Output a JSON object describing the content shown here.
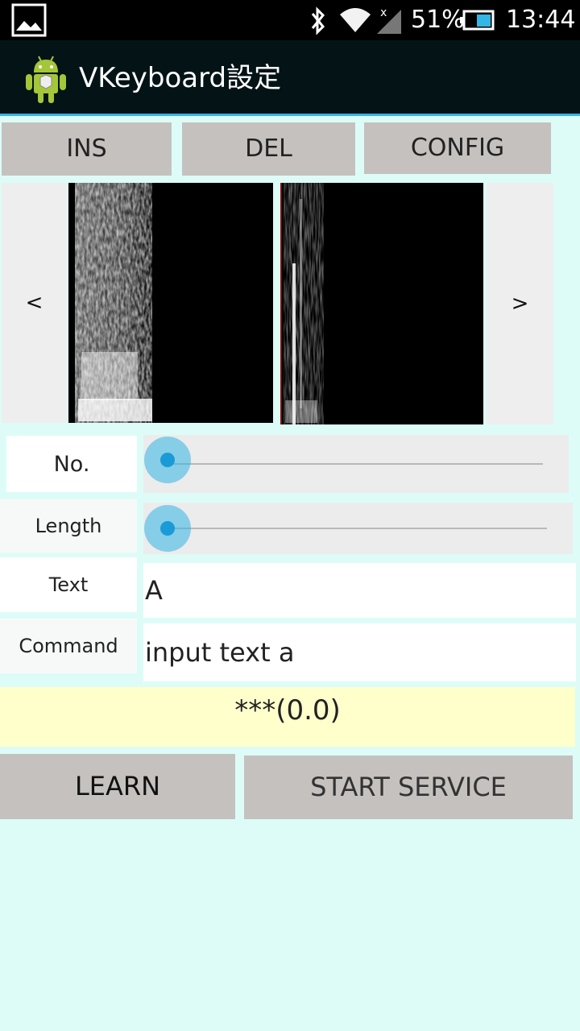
{
  "status_bar": {
    "battery": "51%",
    "time": "13:44",
    "icons": [
      "gallery-icon",
      "bluetooth-icon",
      "wifi-icon",
      "signal-icon",
      "battery-icon"
    ]
  },
  "app": {
    "title": "VKeyboard設定",
    "icon": "android-icon"
  },
  "toolbar": {
    "ins": "INS",
    "del": "DEL",
    "config": "CONFIG"
  },
  "gallery": {
    "prev": "<",
    "next": ">"
  },
  "form": {
    "no_label": "No.",
    "no_value": 0,
    "length_label": "Length",
    "length_value": 0,
    "text_label": "Text",
    "text_value": "A",
    "command_label": "Command",
    "command_value": "input text a"
  },
  "result": "***(0.0)",
  "actions": {
    "learn": "LEARN",
    "start_service": "START SERVICE"
  },
  "colors": {
    "background": "#ddfcf7",
    "accent": "#33b5e5",
    "button": "#c5c1bf",
    "result_bg": "#ffffcc"
  }
}
